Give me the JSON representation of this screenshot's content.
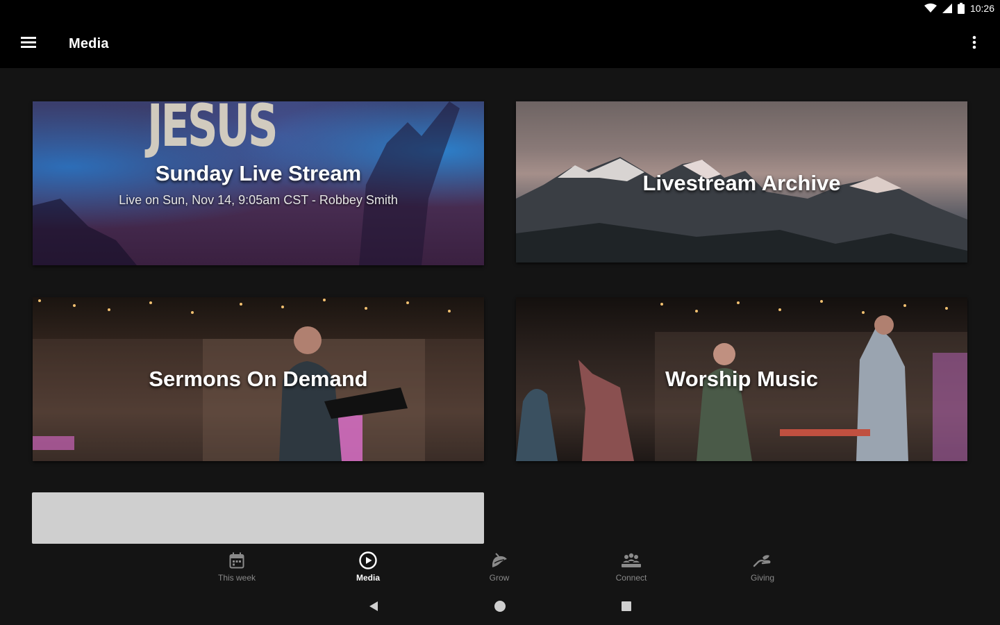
{
  "status_bar": {
    "time": "10:26"
  },
  "app_bar": {
    "title": "Media"
  },
  "cards": [
    {
      "title": "Sunday Live Stream",
      "subtitle": "Live on Sun, Nov 14, 9:05am CST - Robbey Smith",
      "image_text": "JESUS"
    },
    {
      "title": "Livestream Archive"
    },
    {
      "title": "Sermons On Demand"
    },
    {
      "title": "Worship Music"
    }
  ],
  "bottom_nav": [
    {
      "label": "This week",
      "icon": "calendar-icon",
      "active": false
    },
    {
      "label": "Media",
      "icon": "play-circle-icon",
      "active": true
    },
    {
      "label": "Grow",
      "icon": "grow-icon",
      "active": false
    },
    {
      "label": "Connect",
      "icon": "people-icon",
      "active": false
    },
    {
      "label": "Giving",
      "icon": "giving-hand-icon",
      "active": false
    }
  ],
  "colors": {
    "background": "#141414",
    "bar": "#000000",
    "active": "#ffffff",
    "inactive": "#8a8a8a",
    "placeholder": "#cfcfcf"
  }
}
